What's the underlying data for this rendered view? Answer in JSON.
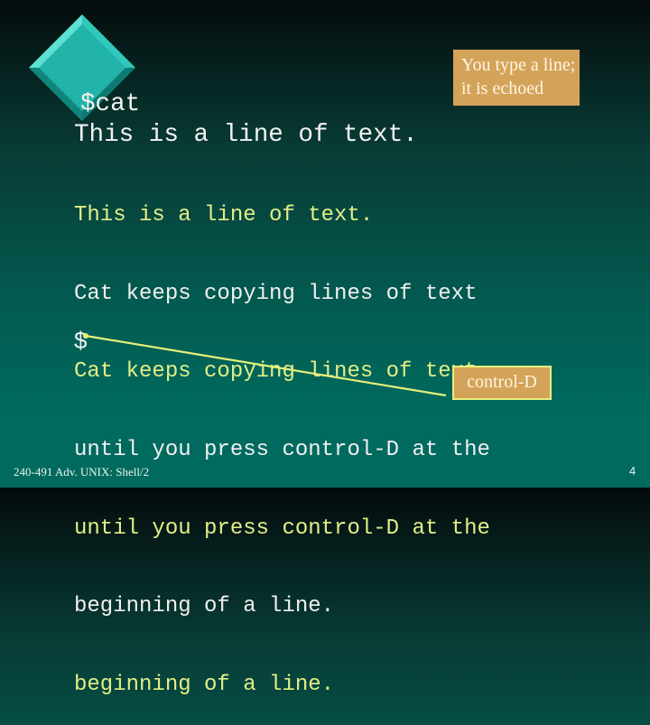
{
  "slide": {
    "command_line": "$cat",
    "typed_first_line": "This is a line of text.",
    "terminal_lines": [
      {
        "text": "This is a line of text.",
        "kind": "echo"
      },
      {
        "text": "Cat keeps copying lines of text",
        "kind": "typed"
      },
      {
        "text": "Cat keeps copying lines of text",
        "kind": "echo"
      },
      {
        "text": "until you press control-D at the",
        "kind": "typed"
      },
      {
        "text": "until you press control-D at the",
        "kind": "echo"
      },
      {
        "text": "beginning of a line.",
        "kind": "typed"
      },
      {
        "text": "beginning of a line.",
        "kind": "echo"
      }
    ],
    "final_prompt": "$",
    "callouts": {
      "echo_note": [
        "You type a line;",
        "it is echoed"
      ],
      "control_d": "control-D"
    },
    "footer": {
      "course": "240-491 Adv. UNIX: Shell/2",
      "page_number": "4"
    }
  },
  "colors": {
    "typed_text": "#f0f0f0",
    "echo_text": "#e2ee86",
    "callout_fill": "#d4a35a",
    "callout_border": "#e4f07a",
    "connector_line": "#e4f07a",
    "diamond_face": "#22b4a8"
  }
}
